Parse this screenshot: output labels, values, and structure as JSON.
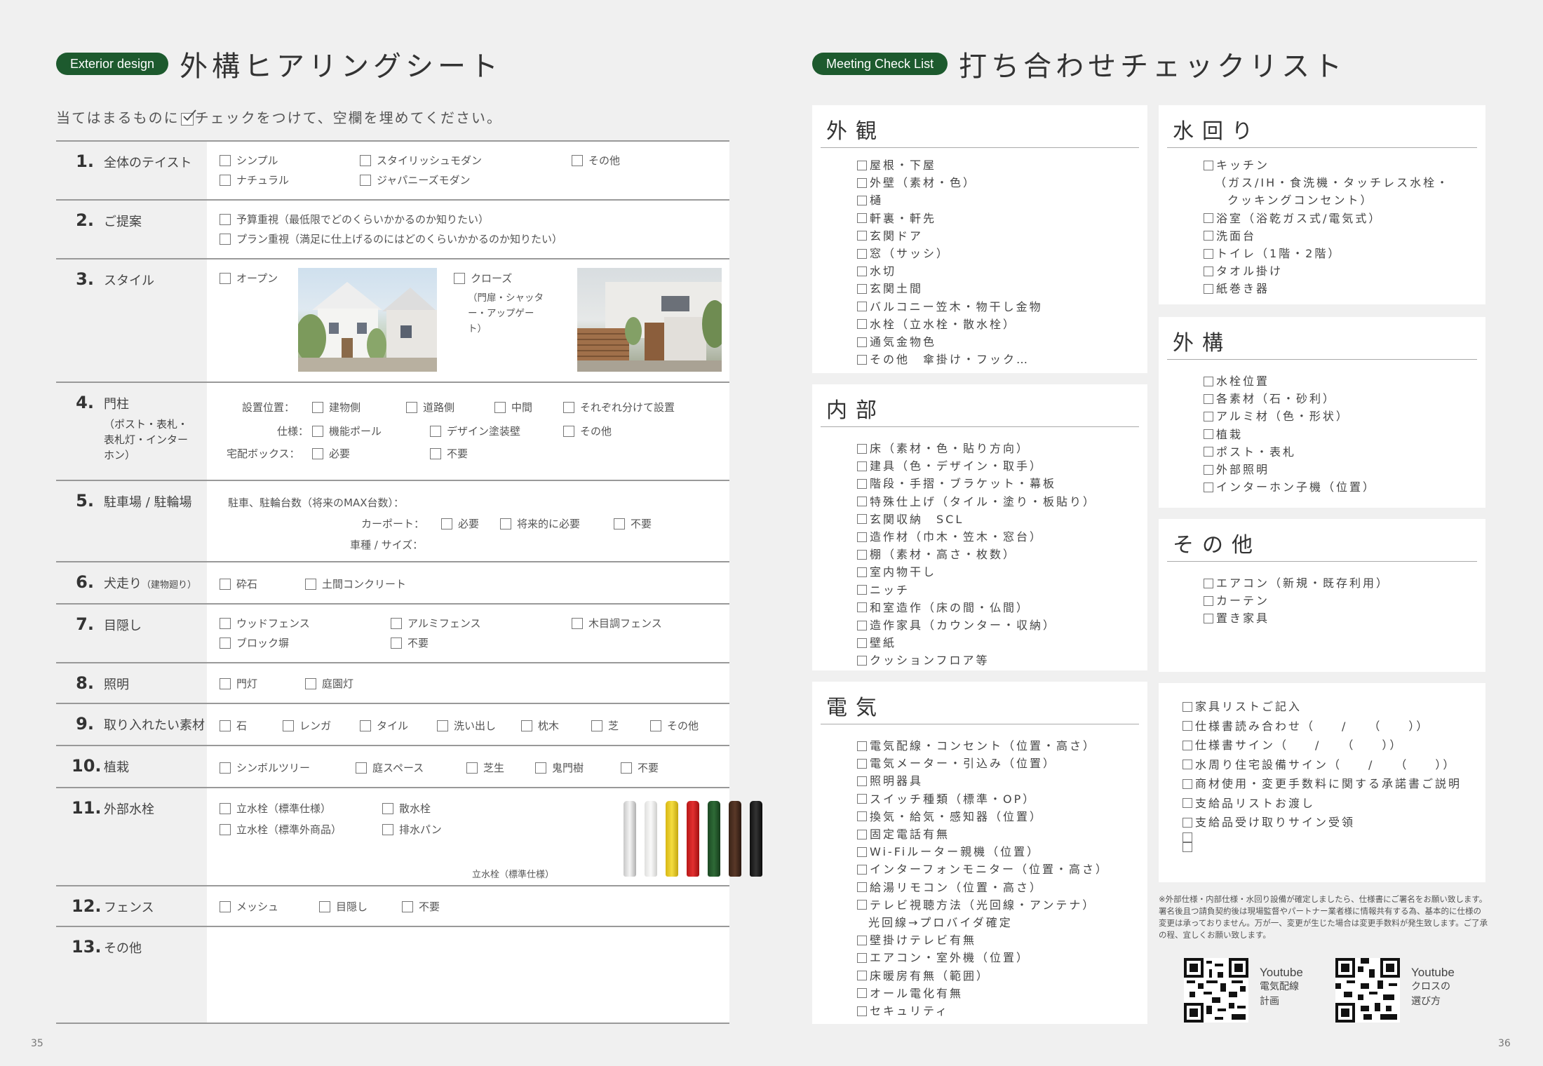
{
  "left": {
    "pill": "Exterior design",
    "title": "外構ヒアリングシート",
    "instruction_a": "当てはまるものに",
    "instruction_b": "チェックをつけて、空欄を埋めてください。",
    "rows": [
      {
        "num": "1.",
        "label": "全体のテイスト",
        "opts": [
          "シンプル",
          "スタイリッシュモダン",
          "その他",
          "ナチュラル",
          "ジャパニーズモダン"
        ]
      },
      {
        "num": "2.",
        "label": "ご提案",
        "opts": [
          "予算重視（最低限でどのくらいかかるのか知りたい）",
          "プラン重視（満足に仕上げるのにはどのくらいかかるのか知りたい）"
        ]
      },
      {
        "num": "3.",
        "label": "スタイル",
        "opts": [
          "オープン",
          "クローズ"
        ],
        "close_note": "（門扉・シャッター・アップゲート）"
      },
      {
        "num": "4.",
        "label": "門柱",
        "sub": "（ポスト・表札・表札灯・インターホン）",
        "f1": "設置位置：",
        "f2": "仕様：",
        "f3": "宅配ボックス：",
        "opts": [
          "建物側",
          "道路側",
          "中間",
          "それぞれ分けて設置",
          "機能ポール",
          "デザイン塗装壁",
          "その他",
          "必要",
          "不要"
        ]
      },
      {
        "num": "5.",
        "label": "駐車場 / 駐輪場",
        "f1": "駐車、駐輪台数（将来のMAX台数）：",
        "f2": "カーポート：",
        "f3": "車種 / サイズ：",
        "opts": [
          "必要",
          "将来的に必要",
          "不要"
        ]
      },
      {
        "num": "6.",
        "label": "犬走り",
        "label_small": "（建物廻り）",
        "opts": [
          "砕石",
          "土間コンクリート"
        ]
      },
      {
        "num": "7.",
        "label": "目隠し",
        "opts": [
          "ウッドフェンス",
          "アルミフェンス",
          "木目調フェンス",
          "ブロック塀",
          "不要"
        ]
      },
      {
        "num": "8.",
        "label": "照明",
        "opts": [
          "門灯",
          "庭園灯"
        ]
      },
      {
        "num": "9.",
        "label": "取り入れたい素材",
        "opts": [
          "石",
          "レンガ",
          "タイル",
          "洗い出し",
          "枕木",
          "芝",
          "その他"
        ]
      },
      {
        "num": "10.",
        "label": "植栽",
        "opts": [
          "シンボルツリー",
          "庭スペース",
          "芝生",
          "鬼門樹",
          "不要"
        ]
      },
      {
        "num": "11.",
        "label": "外部水栓",
        "opts": [
          "立水栓（標準仕様）",
          "散水栓",
          "立水栓（標準外商品）",
          "排水パン"
        ],
        "caption": "立水栓（標準仕様）"
      },
      {
        "num": "12.",
        "label": "フェンス",
        "opts": [
          "メッシュ",
          "目隠し",
          "不要"
        ]
      },
      {
        "num": "13.",
        "label": "その他"
      }
    ],
    "page": "35"
  },
  "right": {
    "pill": "Meeting Check List",
    "title": "打ち合わせチェックリスト",
    "gaikan": {
      "title": "外観",
      "items": [
        "屋根・下屋",
        "外壁（素材・色）",
        "樋",
        "軒裏・軒先",
        "玄関ドア",
        "窓（サッシ）",
        "水切",
        "玄関土間",
        "バルコニー笠木・物干し金物",
        "水栓（立水栓・散水栓）",
        "通気金物色",
        "その他　傘掛け・フック…"
      ]
    },
    "mizu": {
      "title": "水回り",
      "items": [
        "キッチン",
        "（ガス/IH・食洗機・タッチレス水栓・",
        "クッキングコンセント）",
        "浴室（浴乾ガス式/電気式）",
        "洗面台",
        "トイレ（1階・2階）",
        "タオル掛け",
        "紙巻き器"
      ]
    },
    "gaiko": {
      "title": "外構",
      "items": [
        "水栓位置",
        "各素材（石・砂利）",
        "アルミ材（色・形状）",
        "植栽",
        "ポスト・表札",
        "外部照明",
        "インターホン子機（位置）"
      ]
    },
    "sonota": {
      "title": "その他",
      "items": [
        "エアコン（新規・既存利用）",
        "カーテン",
        "置き家具"
      ]
    },
    "naibu": {
      "title": "内部",
      "items": [
        "床（素材・色・貼り方向）",
        "建具（色・デザイン・取手）",
        "階段・手摺・ブラケット・幕板",
        "特殊仕上げ（タイル・塗り・板貼り）",
        "玄関収納　SCL",
        "造作材（巾木・笠木・窓台）",
        "棚（素材・高さ・枚数）",
        "室内物干し",
        "ニッチ",
        "和室造作（床の間・仏間）",
        "造作家具（カウンター・収納）",
        "壁紙",
        "クッションフロア等"
      ]
    },
    "denki": {
      "title": "電気",
      "items": [
        "電気配線・コンセント（位置・高さ）",
        "電気メーター・引込み（位置）",
        "照明器具",
        "スイッチ種類（標準・OP）",
        "換気・給気・感知器（位置）",
        "固定電話有無",
        "Wi-Fiルーター親機（位置）",
        "インターフォンモニター（位置・高さ）",
        "給湯リモコン（位置・高さ）",
        "テレビ視聴方法（光回線・アンテナ）",
        "光回線→プロバイダ確定",
        "壁掛けテレビ有無",
        "エアコン・室外機（位置）",
        "床暖房有無（範囲）",
        "オール電化有無",
        "セキュリティ"
      ]
    },
    "final": {
      "items": [
        "家具リストご記入",
        "仕様書読み合わせ（　　/　　（　　））",
        "仕様書サイン（　　/　　（　　））",
        "水周り住宅設備サイン（　　/　　（　　））",
        "商材使用・変更手数料に関する承諾書ご説明",
        "支給品リストお渡し",
        "支給品受け取りサイン受領",
        "",
        ""
      ]
    },
    "note": "※外部仕様・内部仕様・水回り設備が確定しましたら、仕様書にご署名をお願い致します。署名後且つ請負契約後は現場監督やパートナー業者様に情報共有する為、基本的に仕様の変更は承っておりません。万が一、変更が生じた場合は変更手数料が発生致します。ご了承の程、宜しくお願い致します。",
    "qr1": [
      "Youtube",
      "電気配線",
      "計画"
    ],
    "qr2": [
      "Youtube",
      "クロスの",
      "選び方"
    ],
    "page": "36"
  }
}
